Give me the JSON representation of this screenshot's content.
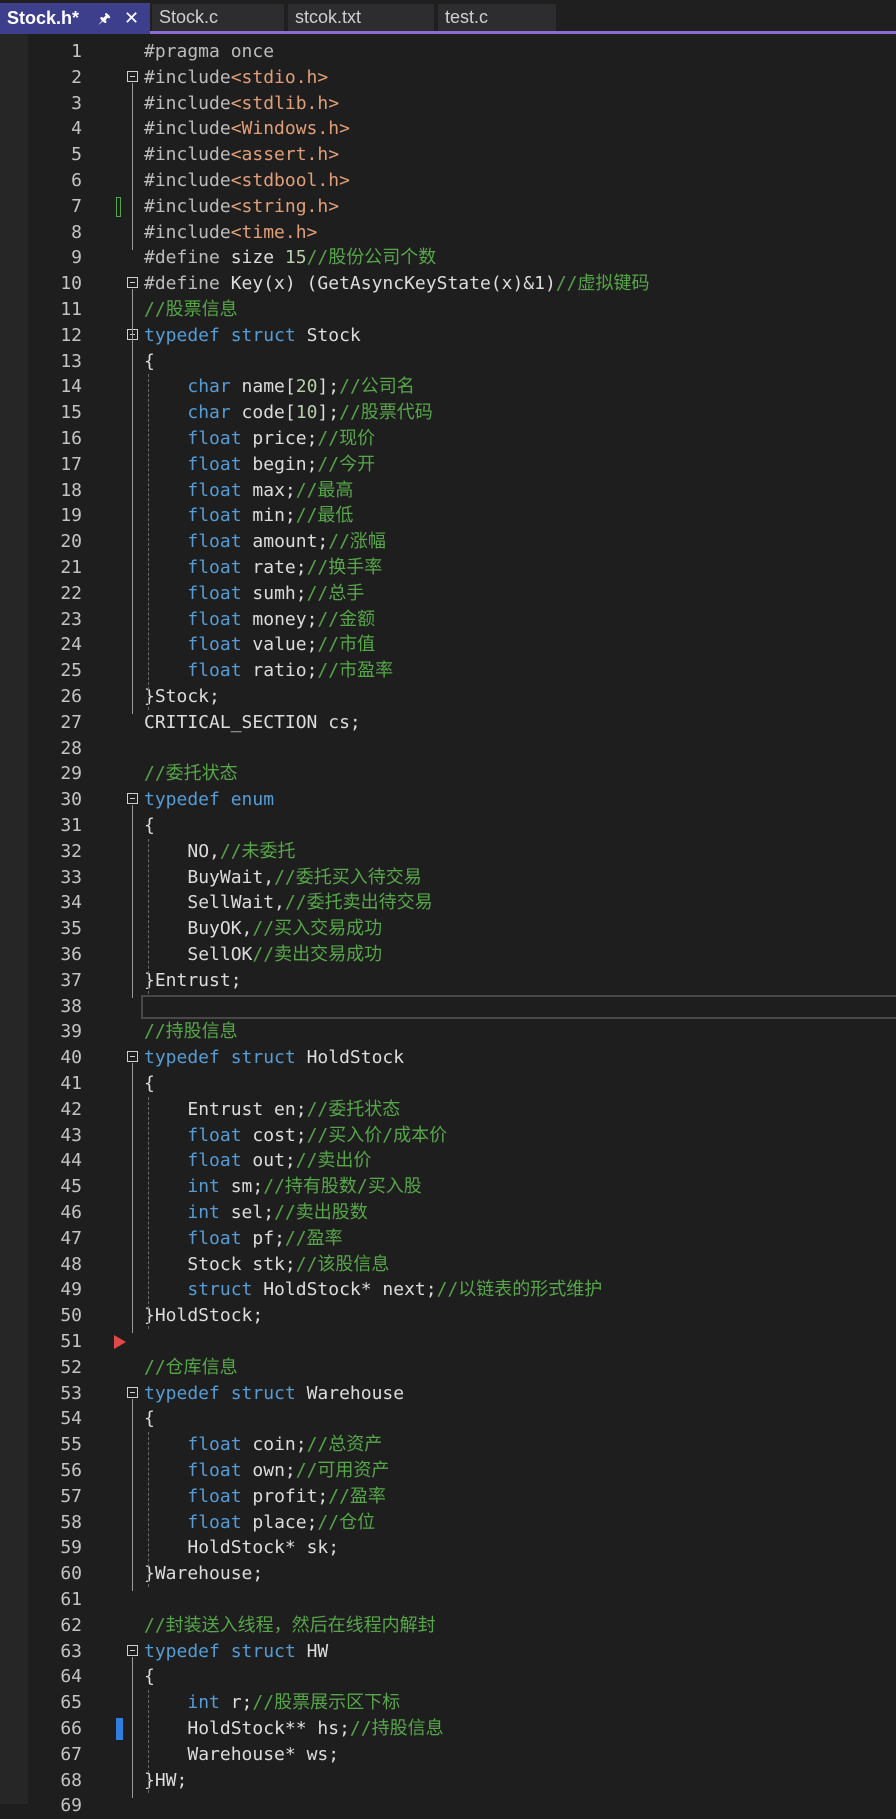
{
  "tabs": [
    {
      "label": "Stock.h*",
      "active": true
    },
    {
      "label": "Stock.c",
      "active": false
    },
    {
      "label": "stcok.txt",
      "active": false
    },
    {
      "label": "test.c",
      "active": false
    }
  ],
  "tab_icons": {
    "pin": "pin-icon",
    "close": "close-icon"
  },
  "colors": {
    "accent": "#8c6bd4",
    "keyword": "#569cd6",
    "comment": "#57a64a",
    "string": "#e09f79",
    "background": "#1e1e1e"
  },
  "code_lines": [
    {
      "n": "1",
      "fold": false,
      "tokens": [
        [
          "pre",
          "#pragma once"
        ]
      ]
    },
    {
      "n": "2",
      "fold": true,
      "tokens": [
        [
          "pre",
          "#include"
        ],
        [
          "str",
          "<stdio.h>"
        ]
      ]
    },
    {
      "n": "3",
      "fold": false,
      "tokens": [
        [
          "pre",
          "#include"
        ],
        [
          "str",
          "<stdlib.h>"
        ]
      ]
    },
    {
      "n": "4",
      "fold": false,
      "tokens": [
        [
          "pre",
          "#include"
        ],
        [
          "str",
          "<Windows.h>"
        ]
      ]
    },
    {
      "n": "5",
      "fold": false,
      "tokens": [
        [
          "pre",
          "#include"
        ],
        [
          "str",
          "<assert.h>"
        ]
      ]
    },
    {
      "n": "6",
      "fold": false,
      "tokens": [
        [
          "pre",
          "#include"
        ],
        [
          "str",
          "<stdbool.h>"
        ]
      ]
    },
    {
      "n": "7",
      "fold": false,
      "tokens": [
        [
          "pre",
          "#include"
        ],
        [
          "str",
          "<string.h>"
        ]
      ]
    },
    {
      "n": "8",
      "fold": false,
      "tokens": [
        [
          "pre",
          "#include"
        ],
        [
          "str",
          "<time.h>"
        ]
      ]
    },
    {
      "n": "9",
      "fold": false,
      "tokens": [
        [
          "pre",
          "#define "
        ],
        [
          "id",
          "size "
        ],
        [
          "num",
          "15"
        ],
        [
          "cm",
          "//股份公司个数"
        ]
      ]
    },
    {
      "n": "10",
      "fold": true,
      "tokens": [
        [
          "pre",
          "#define "
        ],
        [
          "id",
          "Key(x) (GetAsyncKeyState(x)&1)"
        ],
        [
          "cm",
          "//虚拟键码"
        ]
      ]
    },
    {
      "n": "11",
      "fold": false,
      "tokens": [
        [
          "cm",
          "//股票信息"
        ]
      ]
    },
    {
      "n": "12",
      "fold": true,
      "tokens": [
        [
          "kw",
          "typedef "
        ],
        [
          "kw",
          "struct "
        ],
        [
          "id",
          "Stock"
        ]
      ]
    },
    {
      "n": "13",
      "fold": false,
      "tokens": [
        [
          "id",
          "{"
        ]
      ]
    },
    {
      "n": "14",
      "fold": false,
      "tokens": [
        [
          "ws",
          "    "
        ],
        [
          "kw",
          "char "
        ],
        [
          "id",
          "name["
        ],
        [
          "num",
          "20"
        ],
        [
          "id",
          "];"
        ],
        [
          "cm",
          "//公司名"
        ]
      ]
    },
    {
      "n": "15",
      "fold": false,
      "tokens": [
        [
          "ws",
          "    "
        ],
        [
          "kw",
          "char "
        ],
        [
          "id",
          "code["
        ],
        [
          "num",
          "10"
        ],
        [
          "id",
          "];"
        ],
        [
          "cm",
          "//股票代码"
        ]
      ]
    },
    {
      "n": "16",
      "fold": false,
      "tokens": [
        [
          "ws",
          "    "
        ],
        [
          "kw",
          "float "
        ],
        [
          "id",
          "price;"
        ],
        [
          "cm",
          "//现价"
        ]
      ]
    },
    {
      "n": "17",
      "fold": false,
      "tokens": [
        [
          "ws",
          "    "
        ],
        [
          "kw",
          "float "
        ],
        [
          "id",
          "begin;"
        ],
        [
          "cm",
          "//今开"
        ]
      ]
    },
    {
      "n": "18",
      "fold": false,
      "tokens": [
        [
          "ws",
          "    "
        ],
        [
          "kw",
          "float "
        ],
        [
          "id",
          "max;"
        ],
        [
          "cm",
          "//最高"
        ]
      ]
    },
    {
      "n": "19",
      "fold": false,
      "tokens": [
        [
          "ws",
          "    "
        ],
        [
          "kw",
          "float "
        ],
        [
          "id",
          "min;"
        ],
        [
          "cm",
          "//最低"
        ]
      ]
    },
    {
      "n": "20",
      "fold": false,
      "tokens": [
        [
          "ws",
          "    "
        ],
        [
          "kw",
          "float "
        ],
        [
          "id",
          "amount;"
        ],
        [
          "cm",
          "//涨幅"
        ]
      ]
    },
    {
      "n": "21",
      "fold": false,
      "tokens": [
        [
          "ws",
          "    "
        ],
        [
          "kw",
          "float "
        ],
        [
          "id",
          "rate;"
        ],
        [
          "cm",
          "//换手率"
        ]
      ]
    },
    {
      "n": "22",
      "fold": false,
      "tokens": [
        [
          "ws",
          "    "
        ],
        [
          "kw",
          "float "
        ],
        [
          "id",
          "sumh;"
        ],
        [
          "cm",
          "//总手"
        ]
      ]
    },
    {
      "n": "23",
      "fold": false,
      "tokens": [
        [
          "ws",
          "    "
        ],
        [
          "kw",
          "float "
        ],
        [
          "id",
          "money;"
        ],
        [
          "cm",
          "//金额"
        ]
      ]
    },
    {
      "n": "24",
      "fold": false,
      "tokens": [
        [
          "ws",
          "    "
        ],
        [
          "kw",
          "float "
        ],
        [
          "id",
          "value;"
        ],
        [
          "cm",
          "//市值"
        ]
      ]
    },
    {
      "n": "25",
      "fold": false,
      "tokens": [
        [
          "ws",
          "    "
        ],
        [
          "kw",
          "float "
        ],
        [
          "id",
          "ratio;"
        ],
        [
          "cm",
          "//市盈率"
        ]
      ]
    },
    {
      "n": "26",
      "fold": false,
      "tokens": [
        [
          "id",
          "}Stock;"
        ]
      ]
    },
    {
      "n": "27",
      "fold": false,
      "tokens": [
        [
          "id",
          "CRITICAL_SECTION cs;"
        ]
      ]
    },
    {
      "n": "28",
      "fold": false,
      "tokens": []
    },
    {
      "n": "29",
      "fold": false,
      "tokens": [
        [
          "cm",
          "//委托状态"
        ]
      ]
    },
    {
      "n": "30",
      "fold": true,
      "tokens": [
        [
          "kw",
          "typedef "
        ],
        [
          "kw",
          "enum"
        ]
      ]
    },
    {
      "n": "31",
      "fold": false,
      "tokens": [
        [
          "id",
          "{"
        ]
      ]
    },
    {
      "n": "32",
      "fold": false,
      "tokens": [
        [
          "ws",
          "    "
        ],
        [
          "id",
          "NO,"
        ],
        [
          "cm",
          "//未委托"
        ]
      ]
    },
    {
      "n": "33",
      "fold": false,
      "tokens": [
        [
          "ws",
          "    "
        ],
        [
          "id",
          "BuyWait,"
        ],
        [
          "cm",
          "//委托买入待交易"
        ]
      ]
    },
    {
      "n": "34",
      "fold": false,
      "tokens": [
        [
          "ws",
          "    "
        ],
        [
          "id",
          "SellWait,"
        ],
        [
          "cm",
          "//委托卖出待交易"
        ]
      ]
    },
    {
      "n": "35",
      "fold": false,
      "tokens": [
        [
          "ws",
          "    "
        ],
        [
          "id",
          "BuyOK,"
        ],
        [
          "cm",
          "//买入交易成功"
        ]
      ]
    },
    {
      "n": "36",
      "fold": false,
      "tokens": [
        [
          "ws",
          "    "
        ],
        [
          "id",
          "SellOK"
        ],
        [
          "cm",
          "//卖出交易成功"
        ]
      ]
    },
    {
      "n": "37",
      "fold": false,
      "tokens": [
        [
          "id",
          "}Entrust;"
        ]
      ]
    },
    {
      "n": "38",
      "fold": false,
      "tokens": []
    },
    {
      "n": "39",
      "fold": false,
      "tokens": [
        [
          "cm",
          "//持股信息"
        ]
      ]
    },
    {
      "n": "40",
      "fold": true,
      "tokens": [
        [
          "kw",
          "typedef "
        ],
        [
          "kw",
          "struct "
        ],
        [
          "id",
          "HoldStock"
        ]
      ]
    },
    {
      "n": "41",
      "fold": false,
      "tokens": [
        [
          "id",
          "{"
        ]
      ]
    },
    {
      "n": "42",
      "fold": false,
      "tokens": [
        [
          "ws",
          "    "
        ],
        [
          "id",
          "Entrust en;"
        ],
        [
          "cm",
          "//委托状态"
        ]
      ]
    },
    {
      "n": "43",
      "fold": false,
      "tokens": [
        [
          "ws",
          "    "
        ],
        [
          "kw",
          "float "
        ],
        [
          "id",
          "cost;"
        ],
        [
          "cm",
          "//买入价/成本价"
        ]
      ]
    },
    {
      "n": "44",
      "fold": false,
      "tokens": [
        [
          "ws",
          "    "
        ],
        [
          "kw",
          "float "
        ],
        [
          "id",
          "out;"
        ],
        [
          "cm",
          "//卖出价"
        ]
      ]
    },
    {
      "n": "45",
      "fold": false,
      "tokens": [
        [
          "ws",
          "    "
        ],
        [
          "kw",
          "int "
        ],
        [
          "id",
          "sm;"
        ],
        [
          "cm",
          "//持有股数/买入股"
        ]
      ]
    },
    {
      "n": "46",
      "fold": false,
      "tokens": [
        [
          "ws",
          "    "
        ],
        [
          "kw",
          "int "
        ],
        [
          "id",
          "sel;"
        ],
        [
          "cm",
          "//卖出股数"
        ]
      ]
    },
    {
      "n": "47",
      "fold": false,
      "tokens": [
        [
          "ws",
          "    "
        ],
        [
          "kw",
          "float "
        ],
        [
          "id",
          "pf;"
        ],
        [
          "cm",
          "//盈率"
        ]
      ]
    },
    {
      "n": "48",
      "fold": false,
      "tokens": [
        [
          "ws",
          "    "
        ],
        [
          "id",
          "Stock stk;"
        ],
        [
          "cm",
          "//该股信息"
        ]
      ]
    },
    {
      "n": "49",
      "fold": false,
      "tokens": [
        [
          "ws",
          "    "
        ],
        [
          "kw",
          "struct "
        ],
        [
          "id",
          "HoldStock* next;"
        ],
        [
          "cm",
          "//以链表的形式维护"
        ]
      ]
    },
    {
      "n": "50",
      "fold": false,
      "tokens": [
        [
          "id",
          "}HoldStock;"
        ]
      ]
    },
    {
      "n": "51",
      "fold": false,
      "tokens": []
    },
    {
      "n": "52",
      "fold": false,
      "tokens": [
        [
          "cm",
          "//仓库信息"
        ]
      ]
    },
    {
      "n": "53",
      "fold": true,
      "tokens": [
        [
          "kw",
          "typedef "
        ],
        [
          "kw",
          "struct "
        ],
        [
          "id",
          "Warehouse"
        ]
      ]
    },
    {
      "n": "54",
      "fold": false,
      "tokens": [
        [
          "id",
          "{"
        ]
      ]
    },
    {
      "n": "55",
      "fold": false,
      "tokens": [
        [
          "ws",
          "    "
        ],
        [
          "kw",
          "float "
        ],
        [
          "id",
          "coin;"
        ],
        [
          "cm",
          "//总资产"
        ]
      ]
    },
    {
      "n": "56",
      "fold": false,
      "tokens": [
        [
          "ws",
          "    "
        ],
        [
          "kw",
          "float "
        ],
        [
          "id",
          "own;"
        ],
        [
          "cm",
          "//可用资产"
        ]
      ]
    },
    {
      "n": "57",
      "fold": false,
      "tokens": [
        [
          "ws",
          "    "
        ],
        [
          "kw",
          "float "
        ],
        [
          "id",
          "profit;"
        ],
        [
          "cm",
          "//盈率"
        ]
      ]
    },
    {
      "n": "58",
      "fold": false,
      "tokens": [
        [
          "ws",
          "    "
        ],
        [
          "kw",
          "float "
        ],
        [
          "id",
          "place;"
        ],
        [
          "cm",
          "//仓位"
        ]
      ]
    },
    {
      "n": "59",
      "fold": false,
      "tokens": [
        [
          "ws",
          "    "
        ],
        [
          "id",
          "HoldStock* sk;"
        ]
      ]
    },
    {
      "n": "60",
      "fold": false,
      "tokens": [
        [
          "id",
          "}Warehouse;"
        ]
      ]
    },
    {
      "n": "61",
      "fold": false,
      "tokens": []
    },
    {
      "n": "62",
      "fold": false,
      "tokens": [
        [
          "cm",
          "//封装送入线程，然后在线程内解封"
        ]
      ]
    },
    {
      "n": "63",
      "fold": true,
      "tokens": [
        [
          "kw",
          "typedef "
        ],
        [
          "kw",
          "struct "
        ],
        [
          "id",
          "HW"
        ]
      ]
    },
    {
      "n": "64",
      "fold": false,
      "tokens": [
        [
          "id",
          "{"
        ]
      ]
    },
    {
      "n": "65",
      "fold": false,
      "tokens": [
        [
          "ws",
          "    "
        ],
        [
          "kw",
          "int "
        ],
        [
          "id",
          "r;"
        ],
        [
          "cm",
          "//股票展示区下标"
        ]
      ]
    },
    {
      "n": "66",
      "fold": false,
      "tokens": [
        [
          "ws",
          "    "
        ],
        [
          "id",
          "HoldStock** hs;"
        ],
        [
          "cm",
          "//持股信息"
        ]
      ]
    },
    {
      "n": "67",
      "fold": false,
      "tokens": [
        [
          "ws",
          "    "
        ],
        [
          "id",
          "Warehouse* ws;"
        ]
      ]
    },
    {
      "n": "68",
      "fold": false,
      "tokens": [
        [
          "id",
          "}HW;"
        ]
      ]
    },
    {
      "n": "69",
      "fold": false,
      "tokens": []
    }
  ]
}
